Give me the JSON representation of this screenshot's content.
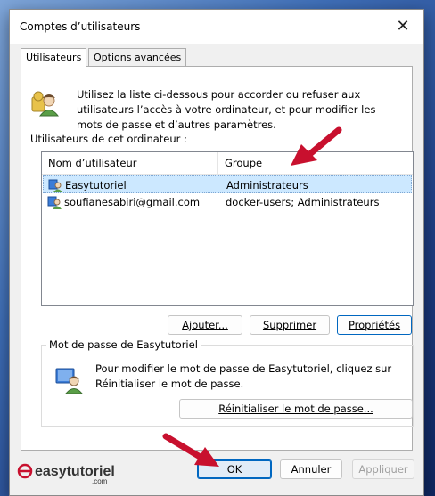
{
  "window": {
    "title": "Comptes d’utilisateurs",
    "close_glyph": "✕"
  },
  "tabs": [
    {
      "label": "Utilisateurs",
      "active": true
    },
    {
      "label": "Options avancées",
      "active": false
    }
  ],
  "intro_text": "Utilisez la liste ci-dessous pour accorder ou refuser aux utilisateurs l’accès à votre ordinateur, et pour modifier les mots de passe et d’autres paramètres.",
  "list": {
    "label": "Utilisateurs de cet ordinateur :",
    "columns": [
      "Nom d’utilisateur",
      "Groupe"
    ],
    "rows": [
      {
        "name": "Easytutoriel",
        "group": "Administrateurs",
        "selected": true
      },
      {
        "name": "soufianesabiri@gmail.com",
        "group": "docker-users; Administrateurs",
        "selected": false
      }
    ]
  },
  "buttons": {
    "add": "Ajouter...",
    "remove": "Supprimer",
    "properties": "Propriétés",
    "reset_password": "Réinitialiser le mot de passe...",
    "ok": "OK",
    "cancel": "Annuler",
    "apply": "Appliquer"
  },
  "password_group": {
    "title": "Mot de passe de Easytutoriel",
    "text": "Pour modifier le mot de passe de Easytutoriel, cliquez sur Réinitialiser le mot de passe."
  },
  "watermark": {
    "brand": "easytutoriel",
    "suffix": ".com"
  },
  "colors": {
    "accent": "#0067c0",
    "selection": "#cce8ff",
    "arrow": "#c8102e"
  },
  "icons": [
    "users-icon",
    "user-row-icon",
    "key-user-icon",
    "close-icon",
    "red-arrow"
  ]
}
